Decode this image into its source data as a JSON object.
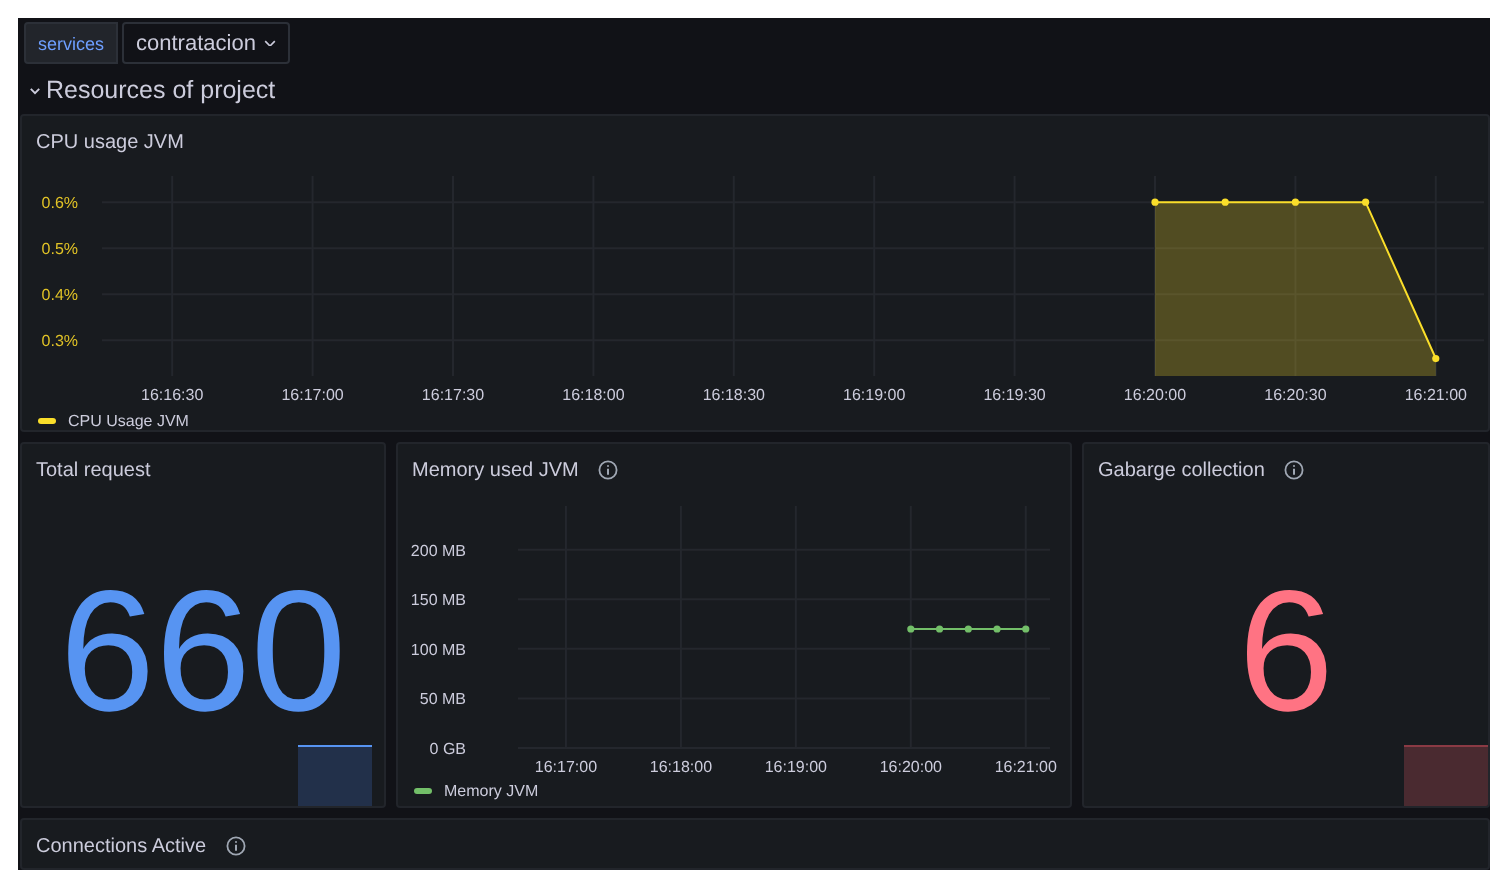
{
  "variables": [
    {
      "label": "services",
      "value": "contratacion"
    }
  ],
  "row": {
    "title": "Resources of project",
    "expanded": true
  },
  "cpu_panel": {
    "title": "CPU usage JVM",
    "chart_data": {
      "type": "area",
      "grid": true,
      "categories": [
        null,
        "16:16:30",
        null,
        "16:17:00",
        null,
        "16:17:30",
        null,
        "16:18:00",
        null,
        "16:18:30",
        null,
        "16:19:00",
        null,
        "16:19:30",
        null,
        "16:20:00",
        null,
        "16:20:30",
        null,
        "16:21:00"
      ],
      "series": [
        {
          "name": "CPU Usage JVM",
          "color": "#fade2a",
          "marker": "circle",
          "values": [
            null,
            null,
            null,
            null,
            null,
            null,
            null,
            null,
            null,
            null,
            null,
            null,
            null,
            null,
            null,
            0.6,
            0.6,
            0.6,
            0.6,
            0.26
          ]
        }
      ],
      "ylim": [
        0.222,
        0.657
      ],
      "yticks": [
        {
          "value": 0.3,
          "label": "0.3%"
        },
        {
          "value": 0.4,
          "label": "0.4%"
        },
        {
          "value": 0.5,
          "label": "0.5%"
        },
        {
          "value": 0.6,
          "label": "0.6%"
        }
      ]
    }
  },
  "total_request": {
    "title": "Total request",
    "value": "660",
    "color": "#5794f2"
  },
  "memory_panel": {
    "title": "Memory used JVM",
    "chart_data": {
      "type": "line",
      "grid": true,
      "categories": [
        null,
        "16:17:00",
        null,
        null,
        null,
        "16:18:00",
        null,
        null,
        null,
        "16:19:00",
        null,
        null,
        null,
        "16:20:00",
        null,
        null,
        null,
        "16:21:00"
      ],
      "series": [
        {
          "name": "Memory JVM",
          "color": "#73bf69",
          "marker": "circle",
          "values": [
            null,
            null,
            null,
            null,
            null,
            null,
            null,
            null,
            null,
            null,
            null,
            null,
            null,
            120,
            120,
            120,
            120,
            120
          ]
        }
      ],
      "ylim": [
        0,
        244
      ],
      "yticks": [
        {
          "value": 0,
          "label": "0 GB"
        },
        {
          "value": 50,
          "label": "50 MB"
        },
        {
          "value": 100,
          "label": "100 MB"
        },
        {
          "value": 150,
          "label": "150 MB"
        },
        {
          "value": 200,
          "label": "200 MB"
        }
      ]
    }
  },
  "gc_panel": {
    "title": "Gabarge collection",
    "value": "6",
    "color": "#ff7383"
  },
  "connections_panel": {
    "title": "Connections Active"
  }
}
